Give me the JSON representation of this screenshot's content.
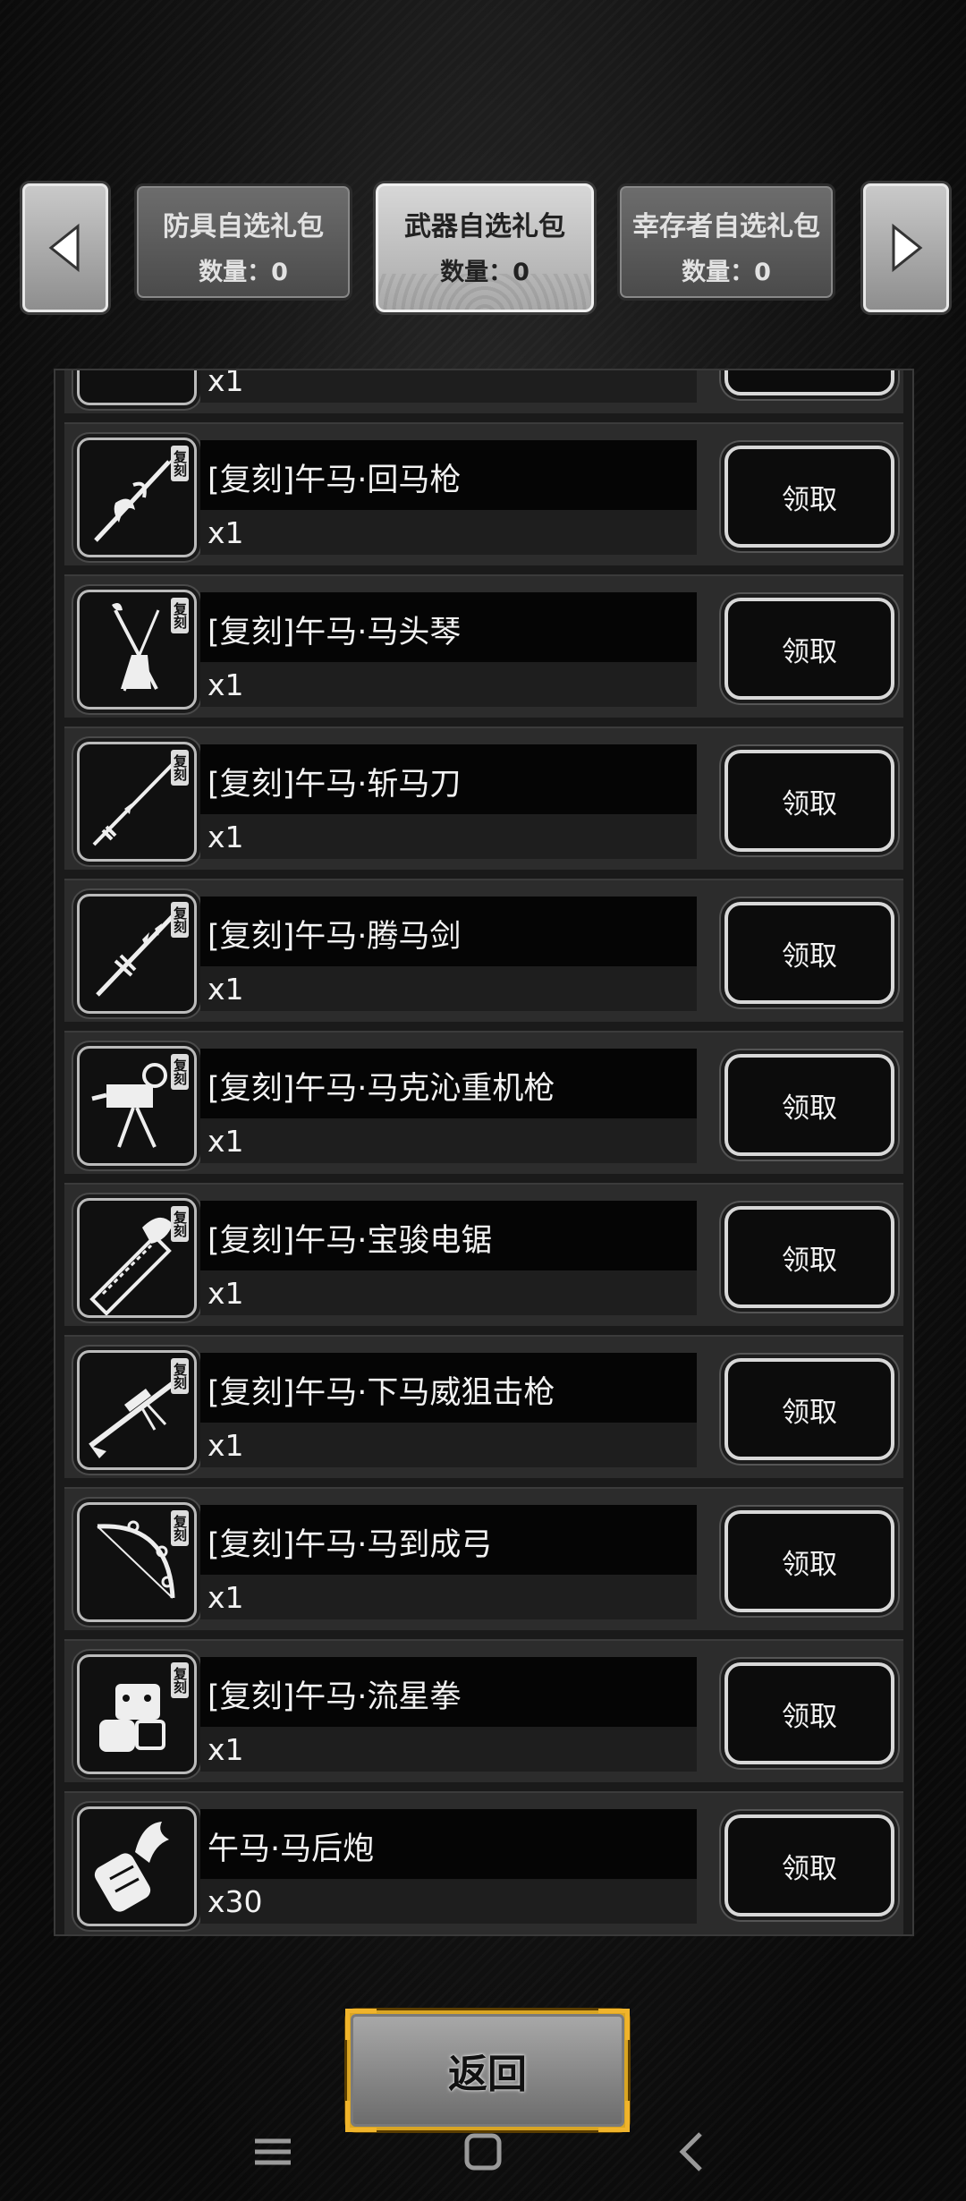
{
  "tabs": {
    "prev_icon": "chevron-left-icon",
    "next_icon": "chevron-right-icon",
    "items": [
      {
        "title": "防具自选礼包",
        "count": "数量：0"
      },
      {
        "title": "武器自选礼包",
        "count": "数量：0"
      },
      {
        "title": "幸存者自选礼包",
        "count": "数量：0"
      }
    ],
    "active_index": 1
  },
  "list": {
    "badge_text": "复刻",
    "claim_label": "领取",
    "partial_top_qty": "x1",
    "items": [
      {
        "name": "[复刻]午马·回马枪",
        "qty": "x1",
        "icon": "spear-icon"
      },
      {
        "name": "[复刻]午马·马头琴",
        "qty": "x1",
        "icon": "horsehead-fiddle-icon"
      },
      {
        "name": "[复刻]午马·斩马刀",
        "qty": "x1",
        "icon": "saber-icon"
      },
      {
        "name": "[复刻]午马·腾马剑",
        "qty": "x1",
        "icon": "sword-icon"
      },
      {
        "name": "[复刻]午马·马克沁重机枪",
        "qty": "x1",
        "icon": "heavy-machine-gun-icon"
      },
      {
        "name": "[复刻]午马·宝骏电锯",
        "qty": "x1",
        "icon": "chainsaw-icon"
      },
      {
        "name": "[复刻]午马·下马威狙击枪",
        "qty": "x1",
        "icon": "sniper-rifle-icon"
      },
      {
        "name": "[复刻]午马·马到成弓",
        "qty": "x1",
        "icon": "bow-icon"
      },
      {
        "name": "[复刻]午马·流星拳",
        "qty": "x1",
        "icon": "gauntlet-icon"
      },
      {
        "name": "午马·马后炮",
        "qty": "x30",
        "icon": "cannon-icon"
      }
    ]
  },
  "return_label": "返回",
  "colors": {
    "accent_gold": "#f0b42b",
    "row_bg": "#2c2c2c"
  }
}
